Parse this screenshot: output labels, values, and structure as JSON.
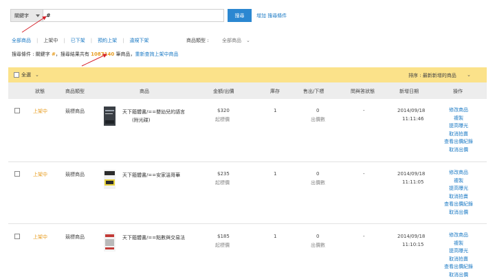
{
  "search": {
    "field_label": "關鍵字",
    "query": "#",
    "button_label": "搜尋",
    "add_condition_label": "增加 搜尋條件"
  },
  "tabs": {
    "items": [
      "全部商品",
      "上架中",
      "已下架",
      "預約上架",
      "違規下架"
    ],
    "active": "上架中"
  },
  "type_filter": {
    "label": "商品類型 :",
    "value": "全部商品"
  },
  "summary": {
    "prefix": "搜尋條件 : 關鍵字",
    "keyword": "#",
    "middle": "，搜尋結果共有",
    "count": "1087140",
    "suffix": "筆商品，",
    "reset_link": "重新查詢上架中商品"
  },
  "toolbar": {
    "select_all_label": "全選",
    "sort_label": "排序 : 最新新增的商品"
  },
  "columns": [
    "狀態",
    "商品類型",
    "商品",
    "金額/出價",
    "庫存",
    "售出/下標",
    "問與答狀態",
    "新增日期",
    "操作"
  ],
  "rows": [
    {
      "status": "上架中",
      "type": "競標商品",
      "name_line1": "天下箍體書/==嬰幼兒的語言",
      "name_line2": "(附光碟)",
      "price": "$320",
      "price_sub": "起標價",
      "stock": "1",
      "sold": "0",
      "sold_sub": "出價數",
      "qa": "-",
      "date": "2014/09/18",
      "time": "11:11:46",
      "actions": [
        "修改商品",
        "複製",
        "提高曝光",
        "取消拍賣",
        "查看出價紀錄",
        "取消出價"
      ]
    },
    {
      "status": "上架中",
      "type": "競標商品",
      "name_line1": "天下箍體書/==安家溫哥華",
      "name_line2": "",
      "price": "$235",
      "price_sub": "起標價",
      "stock": "1",
      "sold": "0",
      "sold_sub": "出價數",
      "qa": "-",
      "date": "2014/09/18",
      "time": "11:11:05",
      "actions": [
        "修改商品",
        "複製",
        "提高曝光",
        "取消拍賣",
        "查看出價紀錄",
        "取消出價"
      ]
    },
    {
      "status": "上架中",
      "type": "競標商品",
      "name_line1": "天下箍體書/==點數與交易法",
      "name_line2": "",
      "price": "$185",
      "price_sub": "起標價",
      "stock": "1",
      "sold": "0",
      "sold_sub": "出價數",
      "qa": "-",
      "date": "2014/09/18",
      "time": "11:10:15",
      "actions": [
        "修改商品",
        "複製",
        "提高曝光",
        "取消拍賣",
        "查看出價紀錄",
        "取消出價"
      ]
    }
  ],
  "colors": {
    "accent_blue": "#2b87d1",
    "link_blue": "#1a79c4",
    "status_orange": "#e79c1f",
    "header_yellow": "#fbe28a",
    "annotation_red": "#d6212a"
  }
}
